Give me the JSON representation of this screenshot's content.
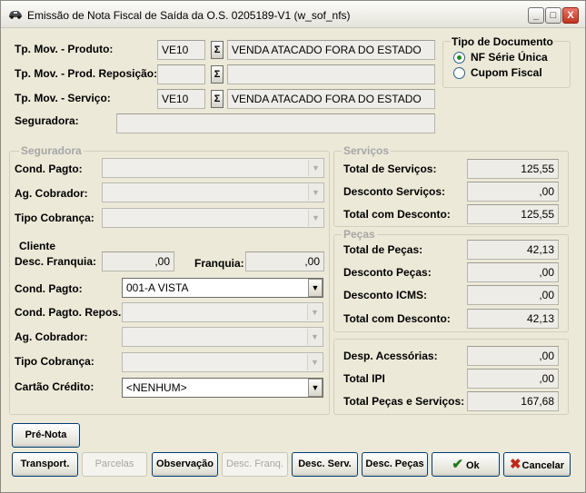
{
  "window": {
    "title": "Emissão de Nota Fiscal de Saída da O.S. 0205189-V1  (w_sof_nfs)",
    "min_label": "_",
    "max_label": "□",
    "close_label": "X"
  },
  "top": {
    "produto_label": "Tp. Mov. - Produto:",
    "produto_code": "VE10",
    "produto_desc": "VENDA ATACADO FORA DO ESTADO",
    "reposicao_label": "Tp. Mov. - Prod. Reposição:",
    "reposicao_code": "",
    "reposicao_desc": "",
    "servico_label": "Tp. Mov. - Serviço:",
    "servico_code": "VE10",
    "servico_desc": "VENDA ATACADO FORA DO ESTADO",
    "seguradora_label": "Seguradora:",
    "seguradora_value": "",
    "sigma": "Σ"
  },
  "tipo_documento": {
    "title": "Tipo de Documento",
    "options": [
      "NF Série Única",
      "Cupom Fiscal"
    ],
    "selected": "NF Série Única"
  },
  "seguradora_group": {
    "title": "Seguradora",
    "cond_pagto_label": "Cond. Pagto:",
    "ag_cobrador_label": "Ag. Cobrador:",
    "tipo_cobranca_label": "Tipo Cobrança:"
  },
  "cliente_group": {
    "title": "Cliente",
    "desc_franquia_label": "Desc. Franquia:",
    "desc_franquia_value": ",00",
    "franquia_label": "Franquia:",
    "franquia_value": ",00",
    "cond_pagto_label": "Cond. Pagto:",
    "cond_pagto_value": "001-A VISTA",
    "cond_pagto_repos_label": "Cond. Pagto. Repos.:",
    "ag_cobrador_label": "Ag. Cobrador:",
    "tipo_cobranca_label": "Tipo Cobrança:",
    "cartao_label": "Cartão Crédito:",
    "cartao_value": "<NENHUM>"
  },
  "servicos": {
    "title": "Serviços",
    "total_label": "Total de Serviços:",
    "total_value": "125,55",
    "desconto_label": "Desconto Serviços:",
    "desconto_value": ",00",
    "total_desc_label": "Total com Desconto:",
    "total_desc_value": "125,55"
  },
  "pecas": {
    "title": "Peças",
    "total_label": "Total de Peças:",
    "total_value": "42,13",
    "desconto_label": "Desconto Peças:",
    "desconto_value": ",00",
    "icms_label": "Desconto ICMS:",
    "icms_value": ",00",
    "total_desc_label": "Total com Desconto:",
    "total_desc_value": "42,13"
  },
  "totais": {
    "acessorias_label": "Desp. Acessórias:",
    "acessorias_value": ",00",
    "ipi_label": "Total IPI",
    "ipi_value": ",00",
    "total_label": "Total Peças e Serviços:",
    "total_value": "167,68"
  },
  "buttons": {
    "pre_nota": "Pré-Nota",
    "transport": "Transport.",
    "parcelas": "Parcelas",
    "observacao": "Observação",
    "desc_franq": "Desc. Franq.",
    "desc_serv": "Desc. Serv.",
    "desc_pecas": "Desc. Peças",
    "ok": "Ok",
    "cancelar": "Cancelar"
  },
  "colors": {
    "ok_check": "#1f7a1f",
    "cancel_x": "#c0281c"
  }
}
